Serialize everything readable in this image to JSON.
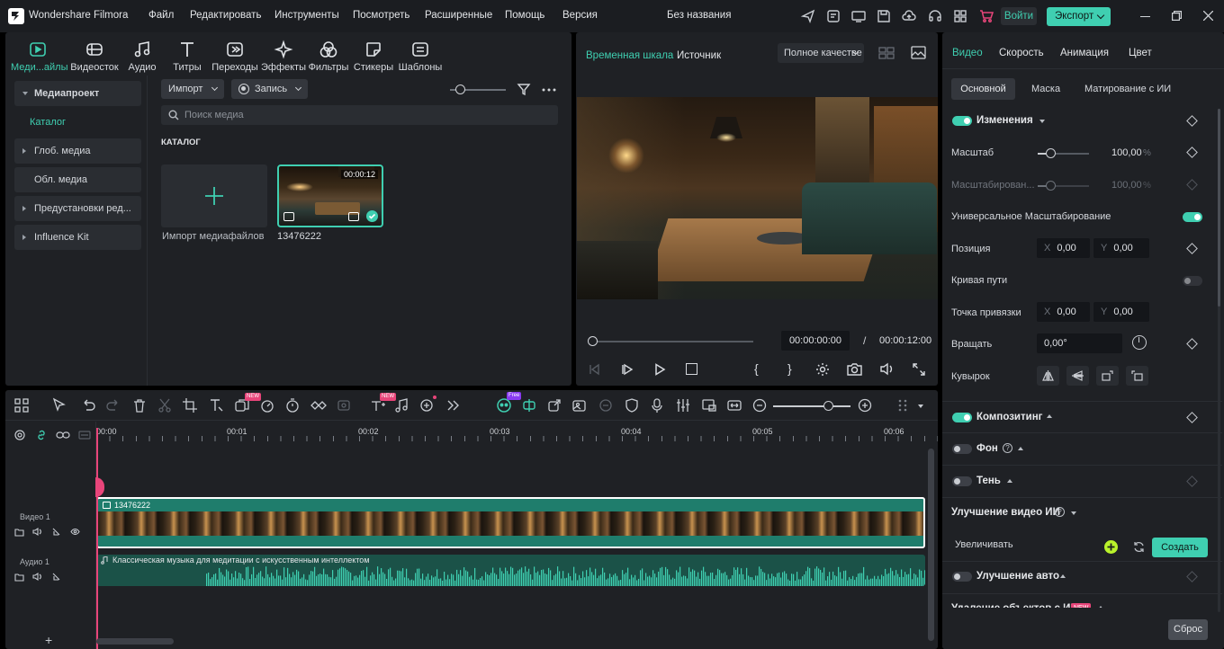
{
  "app": {
    "title": "Wondershare Filmora",
    "project_name": "Без названия",
    "login": "Войти",
    "export": "Экспорт"
  },
  "menu": [
    "Файл",
    "Редактировать",
    "Инструменты",
    "Посмотреть",
    "Расширенные",
    "Помощь",
    "Версия"
  ],
  "media_tabs": [
    {
      "label": "Меди...айлы",
      "icon": "media-icon"
    },
    {
      "label": "Видеосток",
      "icon": "stock-video-icon"
    },
    {
      "label": "Аудио",
      "icon": "music-icon"
    },
    {
      "label": "Титры",
      "icon": "text-icon"
    },
    {
      "label": "Переходы",
      "icon": "transition-icon"
    },
    {
      "label": "Эффекты",
      "icon": "effects-icon"
    },
    {
      "label": "Фильтры",
      "icon": "filters-icon"
    },
    {
      "label": "Стикеры",
      "icon": "sticker-icon"
    },
    {
      "label": "Шаблоны",
      "icon": "template-icon"
    }
  ],
  "sidebar": [
    {
      "label": "Медиапроект"
    },
    {
      "label": "Каталог"
    },
    {
      "label": "Глоб. медиа"
    },
    {
      "label": "Обл. медиа"
    },
    {
      "label": "Предустановки ред..."
    },
    {
      "label": "Influence Kit"
    }
  ],
  "media": {
    "import_btn": "Импорт",
    "record_btn": "Запись",
    "search_placeholder": "Поиск медиа",
    "section": "КАТАЛОГ",
    "import_tile": "Импорт медиафайлов",
    "clip_name": "13476222",
    "clip_duration": "00:00:12"
  },
  "preview": {
    "tab_timeline": "Временная шкала",
    "tab_source": "Источник",
    "quality": "Полное качестве",
    "current_time": "00:00:00:00",
    "separator": "/",
    "total_time": "00:00:12:00",
    "open_brace": "{",
    "close_brace": "}"
  },
  "props": {
    "tabs": [
      "Видео",
      "Скорость",
      "Анимация",
      "Цвет"
    ],
    "subtabs": [
      "Основной",
      "Маска",
      "Матирование с ИИ"
    ],
    "transform": "Изменения",
    "scale": "Масштаб",
    "scale_value": "100,00",
    "scale_unit": "%",
    "scale_fraction": 0.25,
    "scaling": "Масштабирован...",
    "scaling_value": "100,00",
    "scaling_unit": "%",
    "universal_scaling": "Универсальное Масштабирование",
    "position": "Позиция",
    "pos_x": "0,00",
    "pos_y": "0,00",
    "axis_x": "X",
    "axis_y": "Y",
    "path_curve": "Кривая пути",
    "anchor": "Точка привязки",
    "anchor_x": "0,00",
    "anchor_y": "0,00",
    "rotate": "Вращать",
    "rotate_value": "0,00°",
    "flip": "Кувырок",
    "compositing": "Композитинг",
    "background": "Фон",
    "shadow": "Тень",
    "ai_video": "Улучшение видео ИИ",
    "upscale": "Увеличивать",
    "create": "Создать",
    "auto_enhance": "Улучшение авто",
    "ai_remove": "Удаление объектов с ИИ",
    "new_badge": "NEW",
    "reset": "Сброс"
  },
  "timeline": {
    "ruler": [
      "00:00",
      "00:01",
      "00:02",
      "00:03",
      "00:04",
      "00:05",
      "00:06"
    ],
    "video_track": "Видео 1",
    "audio_track": "Аудио 1",
    "video_clip": "13476222",
    "audio_clip": "Классическая музыка для медитации с искусственным интеллектом",
    "new_badge": "NEW",
    "free_badge": "Free",
    "add": "+"
  },
  "colors": {
    "accent": "#3fcfb1",
    "bg": "#1f2125",
    "clip": "#1f7d6c"
  }
}
